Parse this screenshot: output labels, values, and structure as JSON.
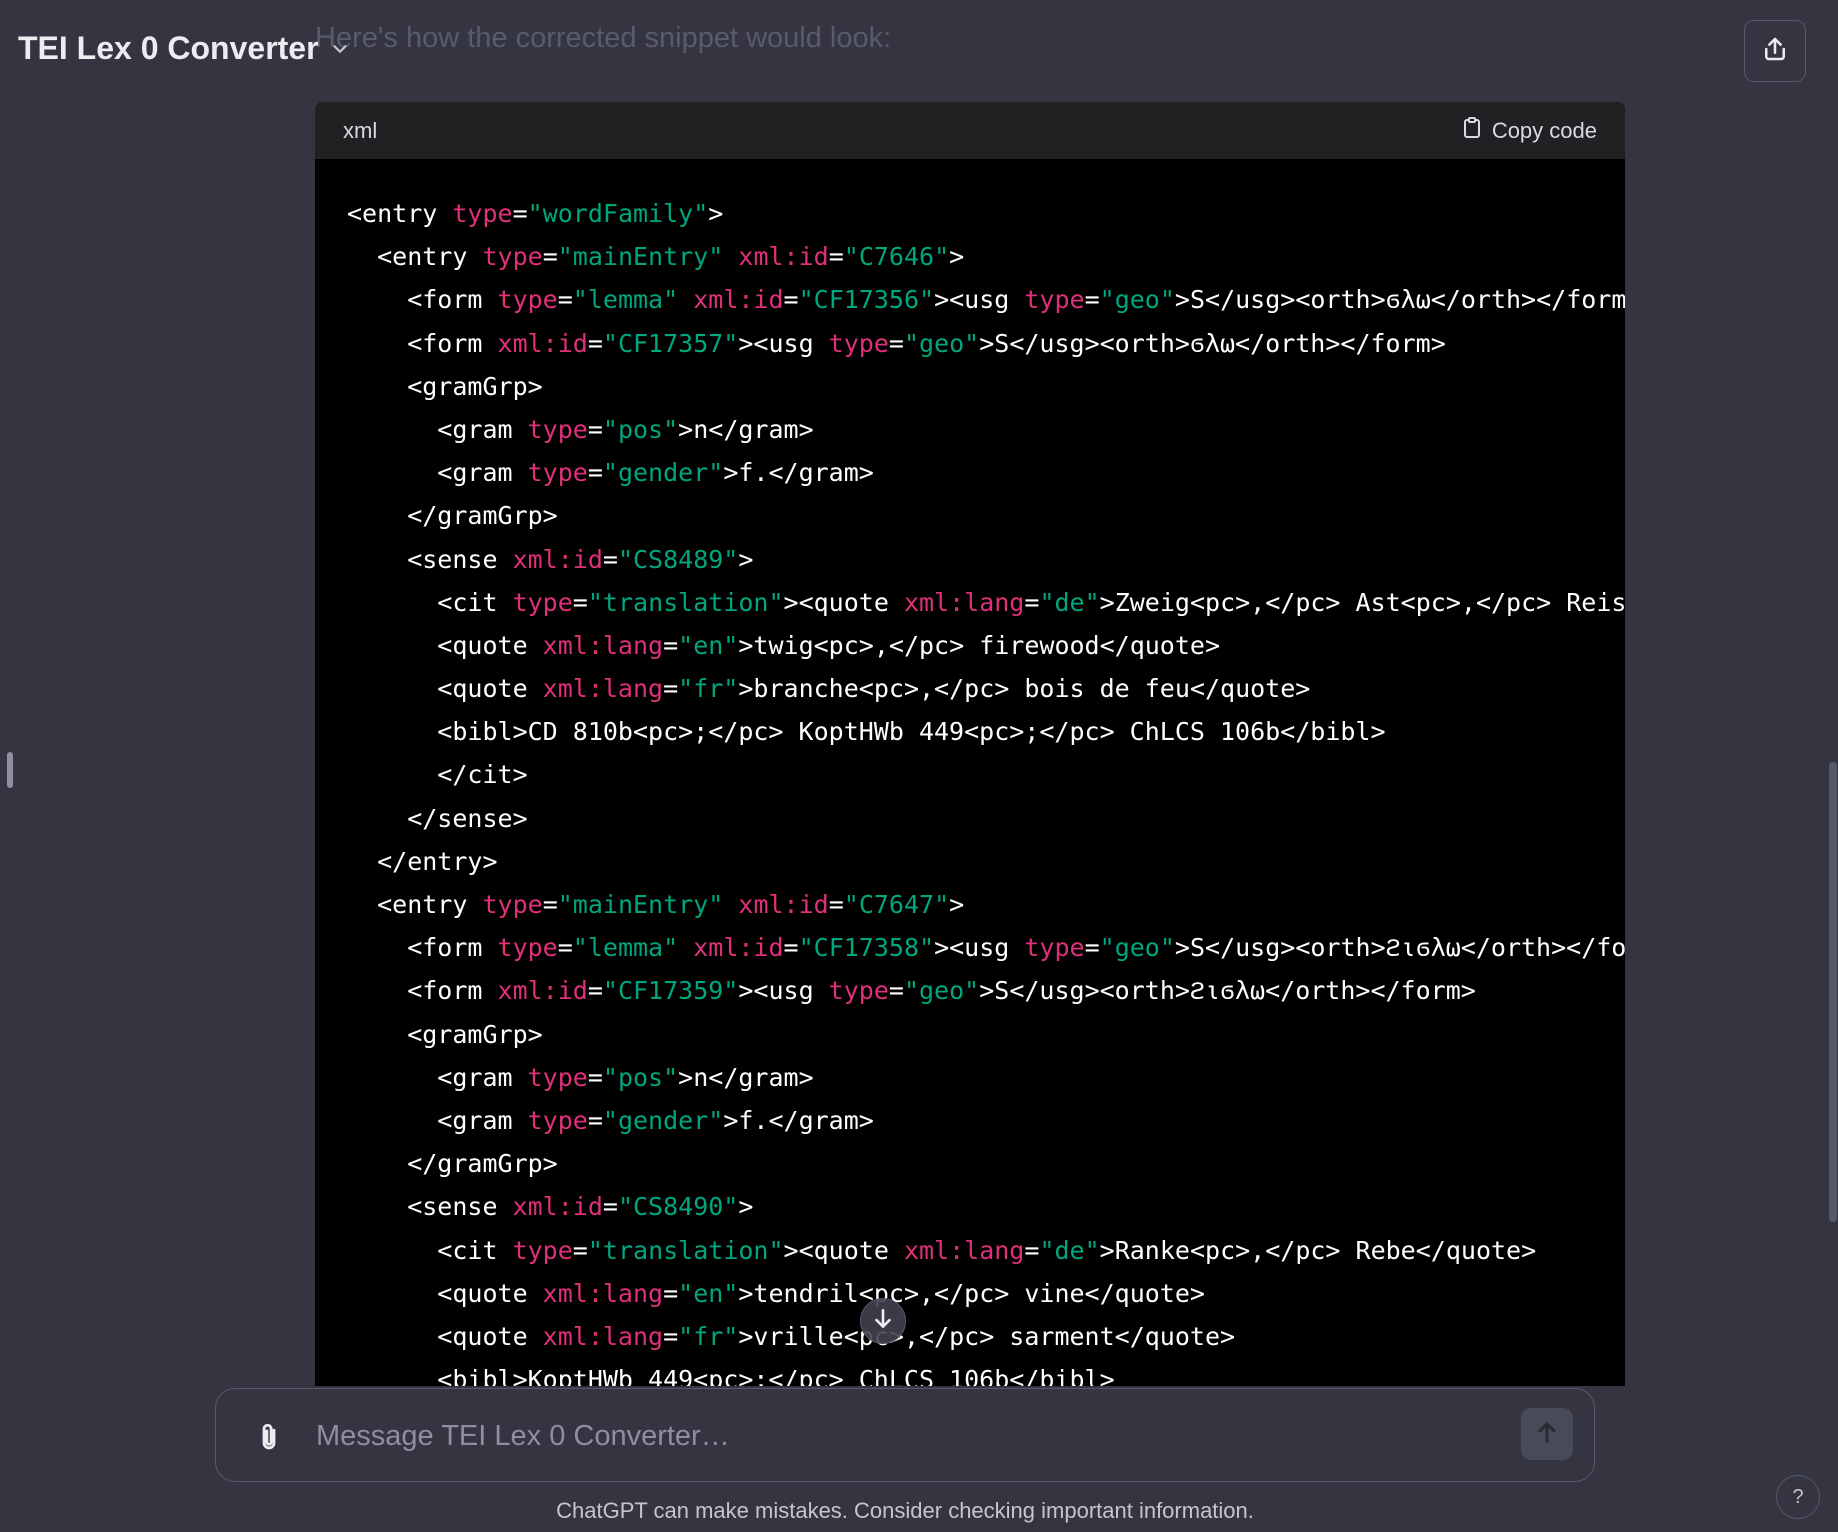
{
  "header": {
    "title": "TEI Lex 0 Converter"
  },
  "conversation": {
    "intro": "Here's how the corrected snippet would look:"
  },
  "code_block": {
    "language": "xml",
    "copy_label": "Copy code",
    "lines": [
      [
        [
          "t",
          "<entry "
        ],
        [
          "a",
          "type"
        ],
        [
          "t",
          "="
        ],
        [
          "v",
          "\"wordFamily\""
        ],
        [
          "t",
          ">"
        ]
      ],
      [
        [
          "t",
          "  <entry "
        ],
        [
          "a",
          "type"
        ],
        [
          "t",
          "="
        ],
        [
          "v",
          "\"mainEntry\""
        ],
        [
          "t",
          " "
        ],
        [
          "a",
          "xml:id"
        ],
        [
          "t",
          "="
        ],
        [
          "v",
          "\"C7646\""
        ],
        [
          "t",
          ">"
        ]
      ],
      [
        [
          "t",
          "    <form "
        ],
        [
          "a",
          "type"
        ],
        [
          "t",
          "="
        ],
        [
          "v",
          "\"lemma\""
        ],
        [
          "t",
          " "
        ],
        [
          "a",
          "xml:id"
        ],
        [
          "t",
          "="
        ],
        [
          "v",
          "\"CF17356\""
        ],
        [
          "t",
          "><usg "
        ],
        [
          "a",
          "type"
        ],
        [
          "t",
          "="
        ],
        [
          "v",
          "\"geo\""
        ],
        [
          "t",
          ">S</usg><orth>ϭλω</orth></form"
        ]
      ],
      [
        [
          "t",
          "    <form "
        ],
        [
          "a",
          "xml:id"
        ],
        [
          "t",
          "="
        ],
        [
          "v",
          "\"CF17357\""
        ],
        [
          "t",
          "><usg "
        ],
        [
          "a",
          "type"
        ],
        [
          "t",
          "="
        ],
        [
          "v",
          "\"geo\""
        ],
        [
          "t",
          ">S</usg><orth>ϭλω</orth></form>"
        ]
      ],
      [
        [
          "t",
          "    <gramGrp>"
        ]
      ],
      [
        [
          "t",
          "      <gram "
        ],
        [
          "a",
          "type"
        ],
        [
          "t",
          "="
        ],
        [
          "v",
          "\"pos\""
        ],
        [
          "t",
          ">n</gram>"
        ]
      ],
      [
        [
          "t",
          "      <gram "
        ],
        [
          "a",
          "type"
        ],
        [
          "t",
          "="
        ],
        [
          "v",
          "\"gender\""
        ],
        [
          "t",
          ">f.</gram>"
        ]
      ],
      [
        [
          "t",
          "    </gramGrp>"
        ]
      ],
      [
        [
          "t",
          "    <sense "
        ],
        [
          "a",
          "xml:id"
        ],
        [
          "t",
          "="
        ],
        [
          "v",
          "\"CS8489\""
        ],
        [
          "t",
          ">"
        ]
      ],
      [
        [
          "t",
          "      <cit "
        ],
        [
          "a",
          "type"
        ],
        [
          "t",
          "="
        ],
        [
          "v",
          "\"translation\""
        ],
        [
          "t",
          "><quote "
        ],
        [
          "a",
          "xml:lang"
        ],
        [
          "t",
          "="
        ],
        [
          "v",
          "\"de\""
        ],
        [
          "t",
          ">Zweig<pc>,</pc> Ast<pc>,</pc> Reis"
        ]
      ],
      [
        [
          "t",
          "      <quote "
        ],
        [
          "a",
          "xml:lang"
        ],
        [
          "t",
          "="
        ],
        [
          "v",
          "\"en\""
        ],
        [
          "t",
          ">twig<pc>,</pc> firewood</quote>"
        ]
      ],
      [
        [
          "t",
          "      <quote "
        ],
        [
          "a",
          "xml:lang"
        ],
        [
          "t",
          "="
        ],
        [
          "v",
          "\"fr\""
        ],
        [
          "t",
          ">branche<pc>,</pc> bois de feu</quote>"
        ]
      ],
      [
        [
          "t",
          "      <bibl>CD 810b<pc>;</pc> KoptHWb 449<pc>;</pc> ChLCS 106b</bibl>"
        ]
      ],
      [
        [
          "t",
          "      </cit>"
        ]
      ],
      [
        [
          "t",
          "    </sense>"
        ]
      ],
      [
        [
          "t",
          "  </entry>"
        ]
      ],
      [
        [
          "t",
          "  <entry "
        ],
        [
          "a",
          "type"
        ],
        [
          "t",
          "="
        ],
        [
          "v",
          "\"mainEntry\""
        ],
        [
          "t",
          " "
        ],
        [
          "a",
          "xml:id"
        ],
        [
          "t",
          "="
        ],
        [
          "v",
          "\"C7647\""
        ],
        [
          "t",
          ">"
        ]
      ],
      [
        [
          "t",
          "    <form "
        ],
        [
          "a",
          "type"
        ],
        [
          "t",
          "="
        ],
        [
          "v",
          "\"lemma\""
        ],
        [
          "t",
          " "
        ],
        [
          "a",
          "xml:id"
        ],
        [
          "t",
          "="
        ],
        [
          "v",
          "\"CF17358\""
        ],
        [
          "t",
          "><usg "
        ],
        [
          "a",
          "type"
        ],
        [
          "t",
          "="
        ],
        [
          "v",
          "\"geo\""
        ],
        [
          "t",
          ">S</usg><orth>ϩιϭλω</orth></fo"
        ]
      ],
      [
        [
          "t",
          "    <form "
        ],
        [
          "a",
          "xml:id"
        ],
        [
          "t",
          "="
        ],
        [
          "v",
          "\"CF17359\""
        ],
        [
          "t",
          "><usg "
        ],
        [
          "a",
          "type"
        ],
        [
          "t",
          "="
        ],
        [
          "v",
          "\"geo\""
        ],
        [
          "t",
          ">S</usg><orth>ϩιϭλω</orth></form>"
        ]
      ],
      [
        [
          "t",
          "    <gramGrp>"
        ]
      ],
      [
        [
          "t",
          "      <gram "
        ],
        [
          "a",
          "type"
        ],
        [
          "t",
          "="
        ],
        [
          "v",
          "\"pos\""
        ],
        [
          "t",
          ">n</gram>"
        ]
      ],
      [
        [
          "t",
          "      <gram "
        ],
        [
          "a",
          "type"
        ],
        [
          "t",
          "="
        ],
        [
          "v",
          "\"gender\""
        ],
        [
          "t",
          ">f.</gram>"
        ]
      ],
      [
        [
          "t",
          "    </gramGrp>"
        ]
      ],
      [
        [
          "t",
          "    <sense "
        ],
        [
          "a",
          "xml:id"
        ],
        [
          "t",
          "="
        ],
        [
          "v",
          "\"CS8490\""
        ],
        [
          "t",
          ">"
        ]
      ],
      [
        [
          "t",
          "      <cit "
        ],
        [
          "a",
          "type"
        ],
        [
          "t",
          "="
        ],
        [
          "v",
          "\"translation\""
        ],
        [
          "t",
          "><quote "
        ],
        [
          "a",
          "xml:lang"
        ],
        [
          "t",
          "="
        ],
        [
          "v",
          "\"de\""
        ],
        [
          "t",
          ">Ranke<pc>,</pc> Rebe</quote>"
        ]
      ],
      [
        [
          "t",
          "      <quote "
        ],
        [
          "a",
          "xml:lang"
        ],
        [
          "t",
          "="
        ],
        [
          "v",
          "\"en\""
        ],
        [
          "t",
          ">tendril<pc>,</pc> vine</quote>"
        ]
      ],
      [
        [
          "t",
          "      <quote "
        ],
        [
          "a",
          "xml:lang"
        ],
        [
          "t",
          "="
        ],
        [
          "v",
          "\"fr\""
        ],
        [
          "t",
          ">vrille<pc>,</pc> sarment</quote>"
        ]
      ],
      [
        [
          "t",
          "      <bibl>KoptHWb 449<pc>;</pc> ChLCS 106b</bibl>"
        ]
      ]
    ]
  },
  "composer": {
    "placeholder": "Message TEI Lex 0 Converter…"
  },
  "footer": {
    "note": "ChatGPT can make mistakes. Consider checking important information.",
    "help_label": "?"
  },
  "colors": {
    "background": "#343541",
    "code_background": "#000000",
    "tag": "#ffffff",
    "attribute": "#df3079",
    "value": "#00a67d"
  },
  "icons": [
    "chevron-down-icon",
    "share-icon",
    "clipboard-icon",
    "arrow-down-icon",
    "paperclip-icon",
    "arrow-up-icon"
  ]
}
